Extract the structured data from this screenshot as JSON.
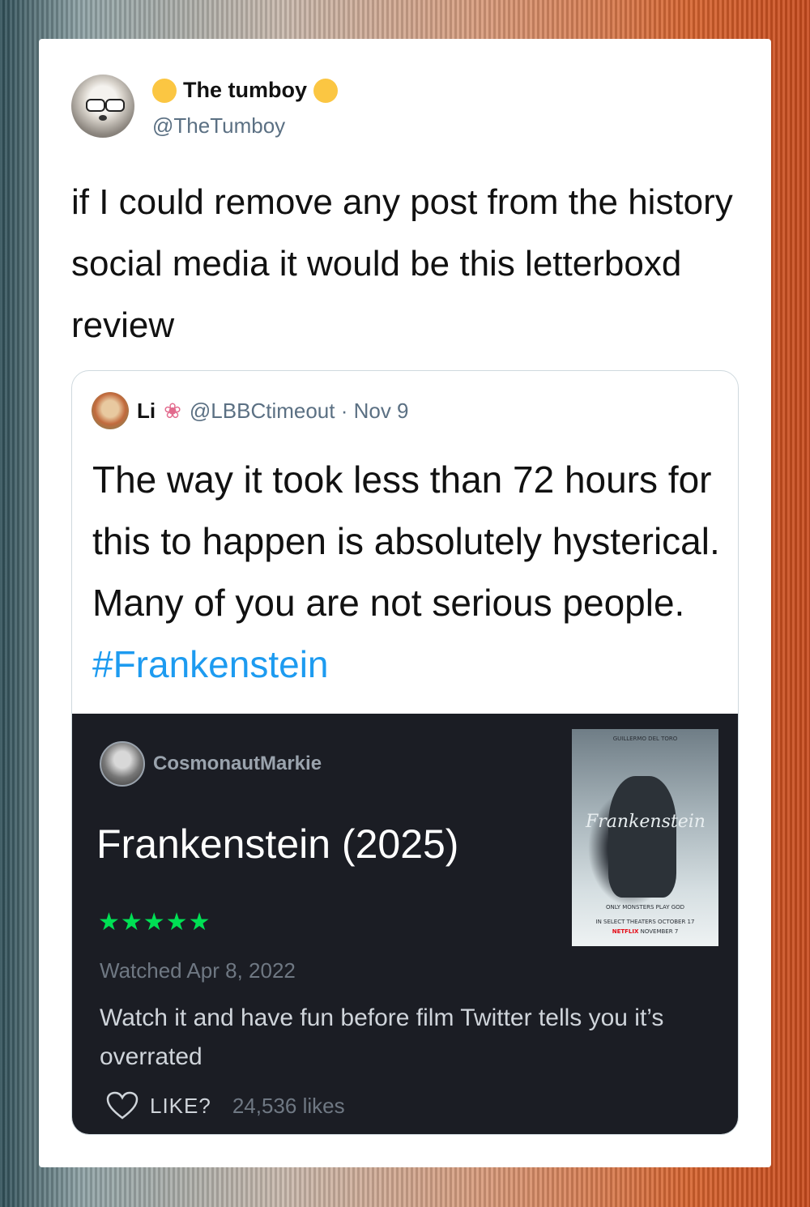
{
  "tweet": {
    "display_name": "The tumboy",
    "handle": "@TheTumboy",
    "text": "if I could remove any post from the history social media it would be this letterboxd review"
  },
  "quoted_tweet": {
    "name": "Li",
    "handle_date": "@LBBCtimeout · Nov 9",
    "text": "The way it took less than 72 hours for this to happen is absolutely hysterical. Many of you are not serious people.",
    "hashtag": "#Frankenstein"
  },
  "letterboxd": {
    "username": "CosmonautMarkie",
    "film_title": "Frankenstein (2025)",
    "rating_stars": 5,
    "stars_text": "★★★★★",
    "watched": "Watched Apr 8, 2022",
    "review": "Watch it and have fun before film Twitter tells you it’s overrated",
    "like_label": "LIKE?",
    "likes_count": "24,536 likes",
    "poster": {
      "director": "GUILLERMO DEL TORO",
      "title": "Frankenstein",
      "tagline": "ONLY MONSTERS PLAY GOD",
      "release_line": "IN SELECT THEATERS OCTOBER 17",
      "platform": "NETFLIX",
      "release_date": "NOVEMBER 7"
    }
  },
  "colors": {
    "star_green": "#00e054",
    "hashtag_blue": "#1d9bf0",
    "badge_yellow": "#fbc642",
    "dark_bg": "#1b1d24"
  },
  "icons": [
    "sunglasses-avatar",
    "yellow-dot-emoji",
    "lotus-emoji",
    "heart-icon"
  ]
}
